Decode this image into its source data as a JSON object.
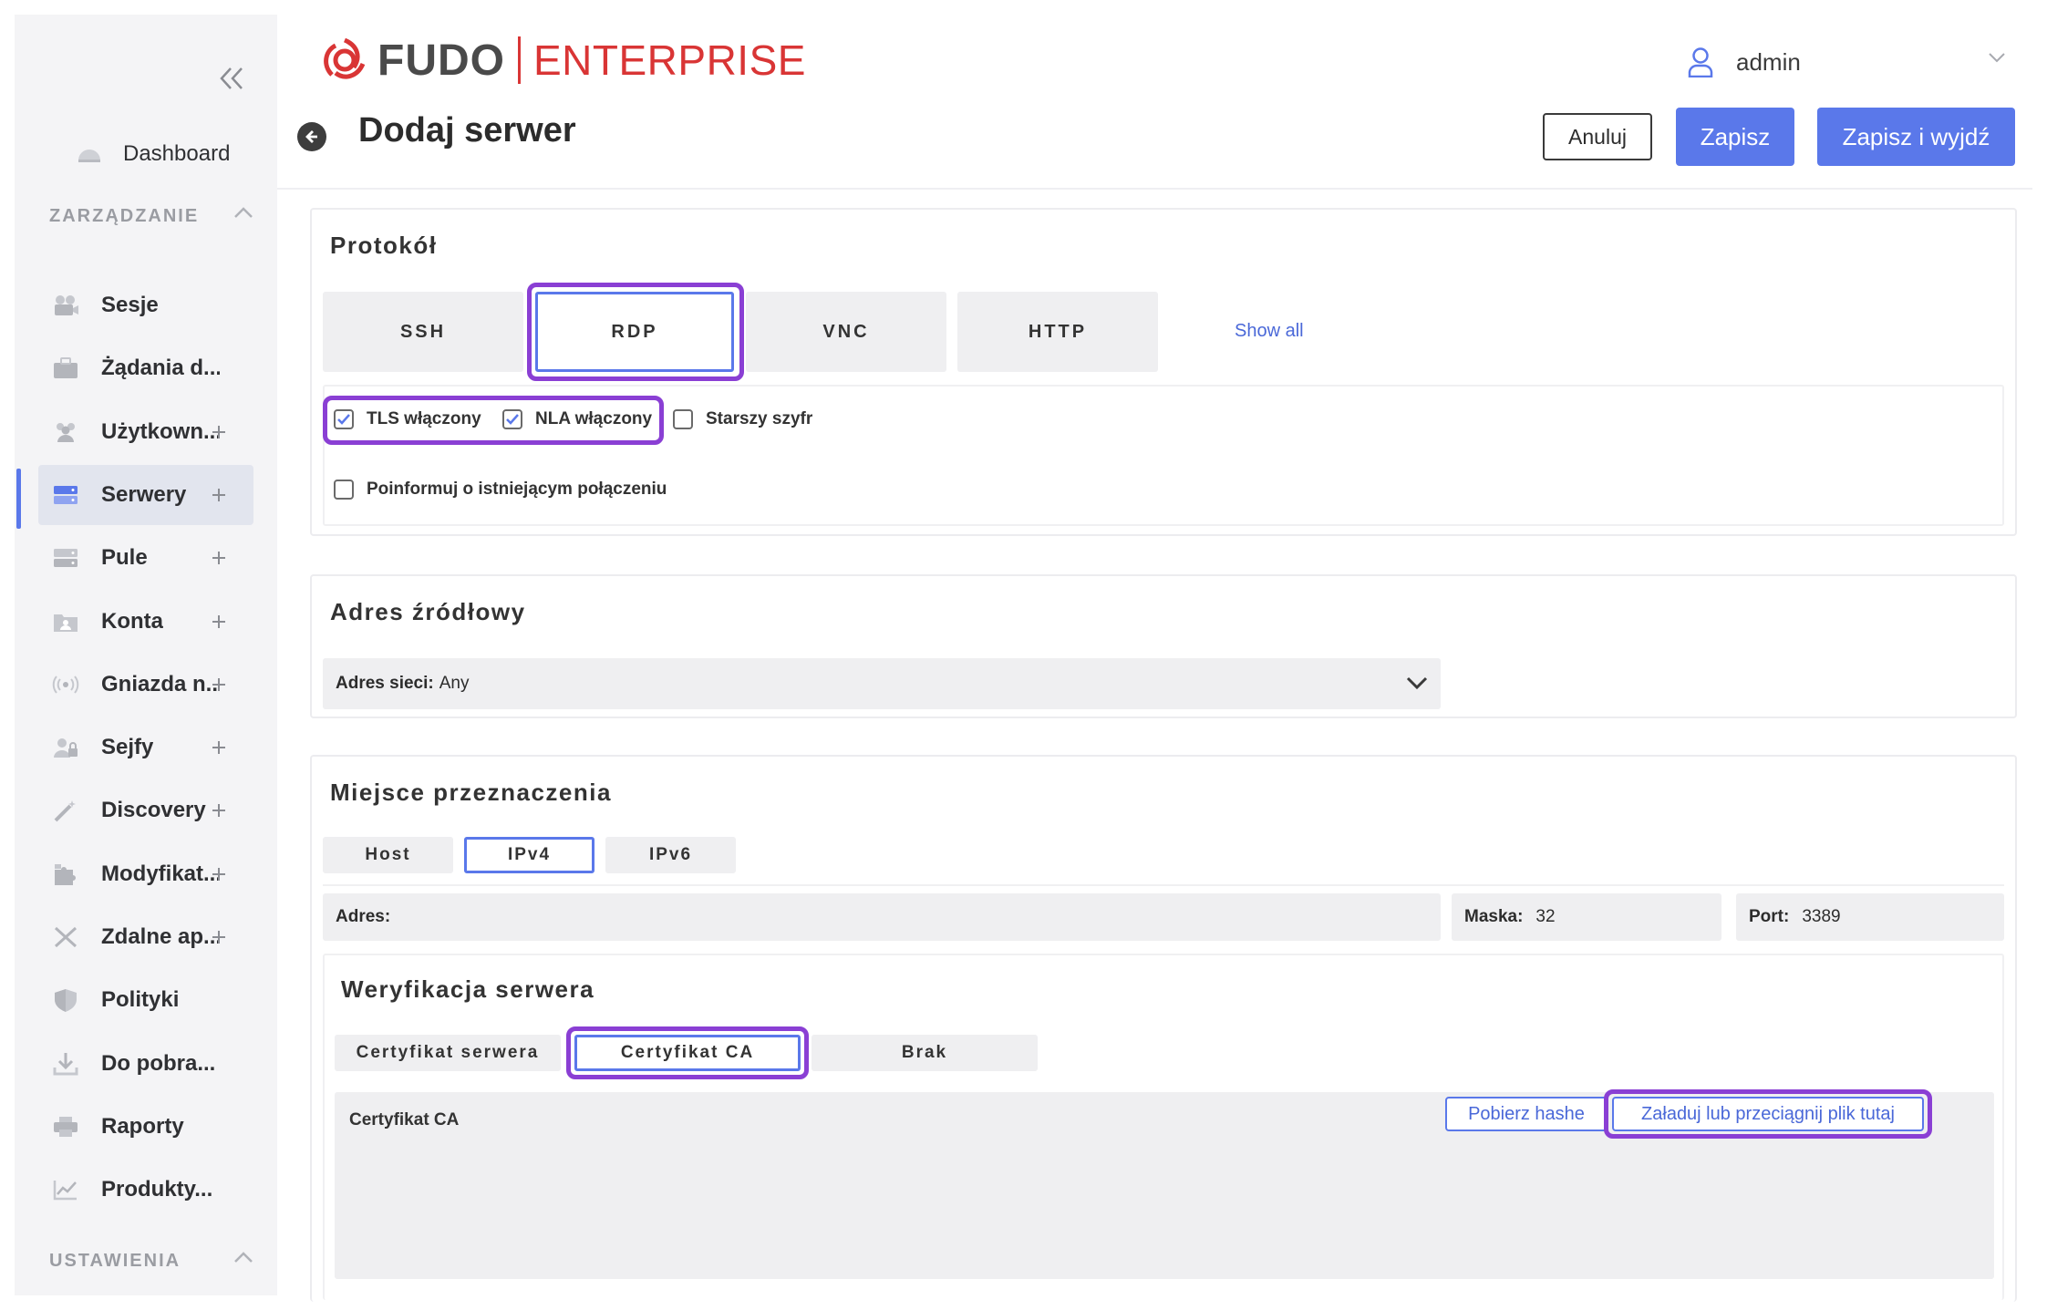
{
  "colors": {
    "accent": "#5a78ea",
    "brand_red": "#d93535",
    "highlight": "#8a3fd4",
    "sidebar_bg": "#f4f4f6"
  },
  "logo": {
    "fudo": "FUDO",
    "enterprise": "ENTERPRISE"
  },
  "user": {
    "name": "admin",
    "icon": "user-icon"
  },
  "sidebar": {
    "dashboard": "Dashboard",
    "section_management": "ZARZĄDZANIE",
    "items": [
      {
        "label": "Sesje",
        "icon": "camera-icon",
        "plus": false
      },
      {
        "label": "Żądania d...",
        "icon": "briefcase-icon",
        "plus": false
      },
      {
        "label": "Użytkown...",
        "icon": "users-icon",
        "plus": true
      },
      {
        "label": "Serwery",
        "icon": "server-icon",
        "plus": true,
        "active": true
      },
      {
        "label": "Pule",
        "icon": "pool-icon",
        "plus": true
      },
      {
        "label": "Konta",
        "icon": "folder-user-icon",
        "plus": true
      },
      {
        "label": "Gniazda n...",
        "icon": "socket-icon",
        "plus": true
      },
      {
        "label": "Sejfy",
        "icon": "safe-icon",
        "plus": true
      },
      {
        "label": "Discovery",
        "icon": "wand-icon",
        "plus": true
      },
      {
        "label": "Modyfikat...",
        "icon": "puzzle-icon",
        "plus": true
      },
      {
        "label": "Zdalne ap...",
        "icon": "tools-icon",
        "plus": true
      },
      {
        "label": "Polityki",
        "icon": "shield-icon",
        "plus": false
      },
      {
        "label": "Do pobra...",
        "icon": "download-icon",
        "plus": false
      },
      {
        "label": "Raporty",
        "icon": "printer-icon",
        "plus": false
      },
      {
        "label": "Produkty...",
        "icon": "chart-icon",
        "plus": false
      }
    ],
    "section_settings": "USTAWIENIA"
  },
  "page": {
    "title": "Dodaj serwer",
    "cancel": "Anuluj",
    "save": "Zapisz",
    "save_exit": "Zapisz i wyjdź"
  },
  "protocol": {
    "title": "Protokół",
    "tabs": [
      "SSH",
      "RDP",
      "VNC",
      "HTTP"
    ],
    "selected": "RDP",
    "show_all": "Show all",
    "options": [
      {
        "label": "TLS włączony",
        "checked": true
      },
      {
        "label": "NLA włączony",
        "checked": true
      },
      {
        "label": "Starszy szyfr",
        "checked": false
      },
      {
        "label": "Poinformuj o istniejącym połączeniu",
        "checked": false
      }
    ]
  },
  "source": {
    "title": "Adres źródłowy",
    "network_label": "Adres sieci:",
    "network_value": "Any"
  },
  "destination": {
    "title": "Miejsce przeznaczenia",
    "tabs": [
      "Host",
      "IPv4",
      "IPv6"
    ],
    "selected": "IPv4",
    "address_label": "Adres:",
    "address_value": "",
    "mask_label": "Maska:",
    "mask_value": "32",
    "port_label": "Port:",
    "port_value": "3389"
  },
  "verification": {
    "title": "Weryfikacja serwera",
    "tabs": [
      "Certyfikat serwera",
      "Certyfikat CA",
      "Brak"
    ],
    "selected": "Certyfikat CA",
    "cert_label": "Certyfikat CA",
    "download_hashes": "Pobierz hashe",
    "upload": "Załaduj lub przeciągnij plik tutaj"
  }
}
